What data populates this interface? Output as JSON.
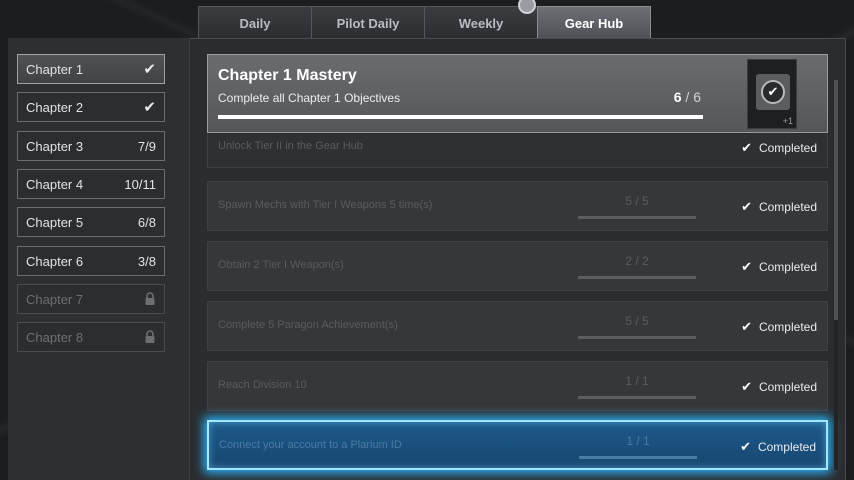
{
  "tabs": [
    {
      "label": "Daily",
      "active": false
    },
    {
      "label": "Pilot Daily",
      "active": false
    },
    {
      "label": "Weekly",
      "active": false
    },
    {
      "label": "Gear Hub",
      "active": true
    }
  ],
  "tab_badge": "",
  "chapters": [
    {
      "label": "Chapter 1",
      "status": "check-icon",
      "progress": "",
      "active": true
    },
    {
      "label": "Chapter 2",
      "status": "check-icon",
      "progress": ""
    },
    {
      "label": "Chapter 3",
      "progress": "7/9"
    },
    {
      "label": "Chapter 4",
      "progress": "10/11"
    },
    {
      "label": "Chapter 5",
      "progress": "6/8"
    },
    {
      "label": "Chapter 6",
      "progress": "3/8"
    },
    {
      "label": "Chapter 7",
      "status": "lock-icon",
      "locked": true
    },
    {
      "label": "Chapter 8",
      "status": "lock-icon",
      "locked": true
    }
  ],
  "mastery": {
    "title": "Chapter 1 Mastery",
    "subtitle": "Complete all Chapter 1 Objectives",
    "current": "6",
    "total": "/ 6",
    "progress_fraction": 1.0,
    "reward_plus": "+1"
  },
  "objectives": [
    {
      "text": "Unlock Tier II in the Gear Hub",
      "progress": "",
      "status": "Completed"
    },
    {
      "text": "Spawn Mechs with Tier I Weapons 5 time(s)",
      "progress": "5 / 5",
      "status": "Completed"
    },
    {
      "text": "Obtain 2 Tier I Weapon(s)",
      "progress": "2 / 2",
      "status": "Completed"
    },
    {
      "text": "Complete 5 Paragon Achievement(s)",
      "progress": "5 / 5",
      "status": "Completed"
    },
    {
      "text": "Reach Division 10",
      "progress": "1 / 1",
      "status": "Completed"
    },
    {
      "text": "Connect your account to a Plarium ID",
      "progress": "1 / 1",
      "status": "Completed"
    }
  ],
  "colors": {
    "highlight": "#2bb7ff",
    "panel": "#2b2c2f",
    "active_tab": "#6d7075"
  }
}
